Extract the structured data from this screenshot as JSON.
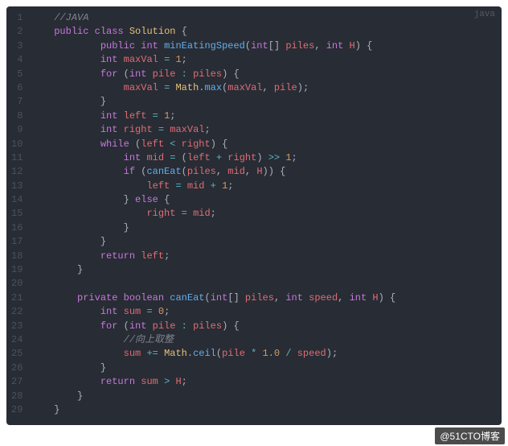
{
  "language_label": "java",
  "watermark": "@51CTO博客",
  "code": {
    "lines": [
      [
        [
          "comment",
          "//JAVA"
        ]
      ],
      [
        [
          "kw",
          "public"
        ],
        [
          "plain",
          " "
        ],
        [
          "kw",
          "class"
        ],
        [
          "plain",
          " "
        ],
        [
          "class",
          "Solution"
        ],
        [
          "plain",
          " "
        ],
        [
          "punc",
          "{"
        ]
      ],
      [
        [
          "plain",
          "        "
        ],
        [
          "kw",
          "public"
        ],
        [
          "plain",
          " "
        ],
        [
          "type",
          "int"
        ],
        [
          "plain",
          " "
        ],
        [
          "method",
          "minEatingSpeed"
        ],
        [
          "punc",
          "("
        ],
        [
          "type",
          "int"
        ],
        [
          "punc",
          "[]"
        ],
        [
          "plain",
          " "
        ],
        [
          "param",
          "piles"
        ],
        [
          "punc",
          ","
        ],
        [
          "plain",
          " "
        ],
        [
          "type",
          "int"
        ],
        [
          "plain",
          " "
        ],
        [
          "param",
          "H"
        ],
        [
          "punc",
          ")"
        ],
        [
          "plain",
          " "
        ],
        [
          "punc",
          "{"
        ]
      ],
      [
        [
          "plain",
          "        "
        ],
        [
          "type",
          "int"
        ],
        [
          "plain",
          " "
        ],
        [
          "var",
          "maxVal"
        ],
        [
          "plain",
          " "
        ],
        [
          "op",
          "="
        ],
        [
          "plain",
          " "
        ],
        [
          "num",
          "1"
        ],
        [
          "punc",
          ";"
        ]
      ],
      [
        [
          "plain",
          "        "
        ],
        [
          "kw",
          "for"
        ],
        [
          "plain",
          " "
        ],
        [
          "punc",
          "("
        ],
        [
          "type",
          "int"
        ],
        [
          "plain",
          " "
        ],
        [
          "var",
          "pile"
        ],
        [
          "plain",
          " "
        ],
        [
          "op",
          ":"
        ],
        [
          "plain",
          " "
        ],
        [
          "var",
          "piles"
        ],
        [
          "punc",
          ")"
        ],
        [
          "plain",
          " "
        ],
        [
          "punc",
          "{"
        ]
      ],
      [
        [
          "plain",
          "            "
        ],
        [
          "var",
          "maxVal"
        ],
        [
          "plain",
          " "
        ],
        [
          "op",
          "="
        ],
        [
          "plain",
          " "
        ],
        [
          "builtin",
          "Math"
        ],
        [
          "punc",
          "."
        ],
        [
          "method",
          "max"
        ],
        [
          "punc",
          "("
        ],
        [
          "var",
          "maxVal"
        ],
        [
          "punc",
          ","
        ],
        [
          "plain",
          " "
        ],
        [
          "var",
          "pile"
        ],
        [
          "punc",
          ")"
        ],
        [
          "punc",
          ";"
        ]
      ],
      [
        [
          "plain",
          "        "
        ],
        [
          "punc",
          "}"
        ]
      ],
      [
        [
          "plain",
          "        "
        ],
        [
          "type",
          "int"
        ],
        [
          "plain",
          " "
        ],
        [
          "var",
          "left"
        ],
        [
          "plain",
          " "
        ],
        [
          "op",
          "="
        ],
        [
          "plain",
          " "
        ],
        [
          "num",
          "1"
        ],
        [
          "punc",
          ";"
        ]
      ],
      [
        [
          "plain",
          "        "
        ],
        [
          "type",
          "int"
        ],
        [
          "plain",
          " "
        ],
        [
          "var",
          "right"
        ],
        [
          "plain",
          " "
        ],
        [
          "op",
          "="
        ],
        [
          "plain",
          " "
        ],
        [
          "var",
          "maxVal"
        ],
        [
          "punc",
          ";"
        ]
      ],
      [
        [
          "plain",
          "        "
        ],
        [
          "kw",
          "while"
        ],
        [
          "plain",
          " "
        ],
        [
          "punc",
          "("
        ],
        [
          "var",
          "left"
        ],
        [
          "plain",
          " "
        ],
        [
          "op",
          "<"
        ],
        [
          "plain",
          " "
        ],
        [
          "var",
          "right"
        ],
        [
          "punc",
          ")"
        ],
        [
          "plain",
          " "
        ],
        [
          "punc",
          "{"
        ]
      ],
      [
        [
          "plain",
          "            "
        ],
        [
          "type",
          "int"
        ],
        [
          "plain",
          " "
        ],
        [
          "var",
          "mid"
        ],
        [
          "plain",
          " "
        ],
        [
          "op",
          "="
        ],
        [
          "plain",
          " "
        ],
        [
          "punc",
          "("
        ],
        [
          "var",
          "left"
        ],
        [
          "plain",
          " "
        ],
        [
          "op",
          "+"
        ],
        [
          "plain",
          " "
        ],
        [
          "var",
          "right"
        ],
        [
          "punc",
          ")"
        ],
        [
          "plain",
          " "
        ],
        [
          "op",
          ">>"
        ],
        [
          "plain",
          " "
        ],
        [
          "num",
          "1"
        ],
        [
          "punc",
          ";"
        ]
      ],
      [
        [
          "plain",
          "            "
        ],
        [
          "kw",
          "if"
        ],
        [
          "plain",
          " "
        ],
        [
          "punc",
          "("
        ],
        [
          "method",
          "canEat"
        ],
        [
          "punc",
          "("
        ],
        [
          "var",
          "piles"
        ],
        [
          "punc",
          ","
        ],
        [
          "plain",
          " "
        ],
        [
          "var",
          "mid"
        ],
        [
          "punc",
          ","
        ],
        [
          "plain",
          " "
        ],
        [
          "var",
          "H"
        ],
        [
          "punc",
          ")"
        ],
        [
          "punc",
          ")"
        ],
        [
          "plain",
          " "
        ],
        [
          "punc",
          "{"
        ]
      ],
      [
        [
          "plain",
          "                "
        ],
        [
          "var",
          "left"
        ],
        [
          "plain",
          " "
        ],
        [
          "op",
          "="
        ],
        [
          "plain",
          " "
        ],
        [
          "var",
          "mid"
        ],
        [
          "plain",
          " "
        ],
        [
          "op",
          "+"
        ],
        [
          "plain",
          " "
        ],
        [
          "num",
          "1"
        ],
        [
          "punc",
          ";"
        ]
      ],
      [
        [
          "plain",
          "            "
        ],
        [
          "punc",
          "}"
        ],
        [
          "plain",
          " "
        ],
        [
          "kw",
          "else"
        ],
        [
          "plain",
          " "
        ],
        [
          "punc",
          "{"
        ]
      ],
      [
        [
          "plain",
          "                "
        ],
        [
          "var",
          "right"
        ],
        [
          "plain",
          " "
        ],
        [
          "op",
          "="
        ],
        [
          "plain",
          " "
        ],
        [
          "var",
          "mid"
        ],
        [
          "punc",
          ";"
        ]
      ],
      [
        [
          "plain",
          "            "
        ],
        [
          "punc",
          "}"
        ]
      ],
      [
        [
          "plain",
          "        "
        ],
        [
          "punc",
          "}"
        ]
      ],
      [
        [
          "plain",
          "        "
        ],
        [
          "kw",
          "return"
        ],
        [
          "plain",
          " "
        ],
        [
          "var",
          "left"
        ],
        [
          "punc",
          ";"
        ]
      ],
      [
        [
          "plain",
          "    "
        ],
        [
          "punc",
          "}"
        ]
      ],
      [],
      [
        [
          "plain",
          "    "
        ],
        [
          "kw",
          "private"
        ],
        [
          "plain",
          " "
        ],
        [
          "type",
          "boolean"
        ],
        [
          "plain",
          " "
        ],
        [
          "method",
          "canEat"
        ],
        [
          "punc",
          "("
        ],
        [
          "type",
          "int"
        ],
        [
          "punc",
          "[]"
        ],
        [
          "plain",
          " "
        ],
        [
          "param",
          "piles"
        ],
        [
          "punc",
          ","
        ],
        [
          "plain",
          " "
        ],
        [
          "type",
          "int"
        ],
        [
          "plain",
          " "
        ],
        [
          "param",
          "speed"
        ],
        [
          "punc",
          ","
        ],
        [
          "plain",
          " "
        ],
        [
          "type",
          "int"
        ],
        [
          "plain",
          " "
        ],
        [
          "param",
          "H"
        ],
        [
          "punc",
          ")"
        ],
        [
          "plain",
          " "
        ],
        [
          "punc",
          "{"
        ]
      ],
      [
        [
          "plain",
          "        "
        ],
        [
          "type",
          "int"
        ],
        [
          "plain",
          " "
        ],
        [
          "var",
          "sum"
        ],
        [
          "plain",
          " "
        ],
        [
          "op",
          "="
        ],
        [
          "plain",
          " "
        ],
        [
          "num",
          "0"
        ],
        [
          "punc",
          ";"
        ]
      ],
      [
        [
          "plain",
          "        "
        ],
        [
          "kw",
          "for"
        ],
        [
          "plain",
          " "
        ],
        [
          "punc",
          "("
        ],
        [
          "type",
          "int"
        ],
        [
          "plain",
          " "
        ],
        [
          "var",
          "pile"
        ],
        [
          "plain",
          " "
        ],
        [
          "op",
          ":"
        ],
        [
          "plain",
          " "
        ],
        [
          "var",
          "piles"
        ],
        [
          "punc",
          ")"
        ],
        [
          "plain",
          " "
        ],
        [
          "punc",
          "{"
        ]
      ],
      [
        [
          "plain",
          "            "
        ],
        [
          "comment",
          "//向上取整"
        ]
      ],
      [
        [
          "plain",
          "            "
        ],
        [
          "var",
          "sum"
        ],
        [
          "plain",
          " "
        ],
        [
          "op",
          "+="
        ],
        [
          "plain",
          " "
        ],
        [
          "builtin",
          "Math"
        ],
        [
          "punc",
          "."
        ],
        [
          "method",
          "ceil"
        ],
        [
          "punc",
          "("
        ],
        [
          "var",
          "pile"
        ],
        [
          "plain",
          " "
        ],
        [
          "op",
          "*"
        ],
        [
          "plain",
          " "
        ],
        [
          "num",
          "1.0"
        ],
        [
          "plain",
          " "
        ],
        [
          "op",
          "/"
        ],
        [
          "plain",
          " "
        ],
        [
          "var",
          "speed"
        ],
        [
          "punc",
          ")"
        ],
        [
          "punc",
          ";"
        ]
      ],
      [
        [
          "plain",
          "        "
        ],
        [
          "punc",
          "}"
        ]
      ],
      [
        [
          "plain",
          "        "
        ],
        [
          "kw",
          "return"
        ],
        [
          "plain",
          " "
        ],
        [
          "var",
          "sum"
        ],
        [
          "plain",
          " "
        ],
        [
          "op",
          ">"
        ],
        [
          "plain",
          " "
        ],
        [
          "var",
          "H"
        ],
        [
          "punc",
          ";"
        ]
      ],
      [
        [
          "plain",
          "    "
        ],
        [
          "punc",
          "}"
        ]
      ],
      [
        [
          "punc",
          "}"
        ]
      ]
    ]
  }
}
